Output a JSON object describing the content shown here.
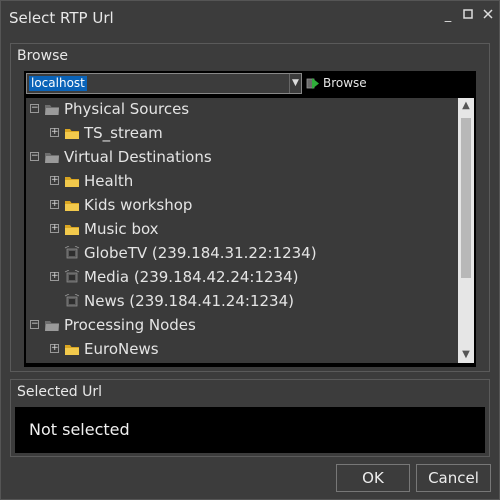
{
  "window": {
    "title": "Select RTP Url"
  },
  "browse": {
    "title": "Browse",
    "host": "localhost",
    "browse_button": "Browse"
  },
  "tree": {
    "nodes": [
      {
        "label": "Physical Sources",
        "level": 0,
        "icon": "folder-gray-icon",
        "expander": "minus"
      },
      {
        "label": "TS_stream",
        "level": 1,
        "icon": "folder-yellow-icon",
        "expander": "plus"
      },
      {
        "label": "Virtual Destinations",
        "level": 0,
        "icon": "folder-gray-icon",
        "expander": "minus"
      },
      {
        "label": "Health",
        "level": 1,
        "icon": "folder-yellow-icon",
        "expander": "plus"
      },
      {
        "label": "Kids workshop",
        "level": 1,
        "icon": "folder-yellow-icon",
        "expander": "plus"
      },
      {
        "label": "Music box",
        "level": 1,
        "icon": "folder-yellow-icon",
        "expander": "plus"
      },
      {
        "label": "GlobeTV (239.184.31.22:1234)",
        "level": 1,
        "icon": "stream-icon",
        "expander": "none"
      },
      {
        "label": "Media (239.184.42.24:1234)",
        "level": 1,
        "icon": "stream-icon",
        "expander": "plus"
      },
      {
        "label": "News  (239.184.41.24:1234)",
        "level": 1,
        "icon": "stream-icon",
        "expander": "none"
      },
      {
        "label": "Processing Nodes",
        "level": 0,
        "icon": "folder-gray-icon",
        "expander": "minus"
      },
      {
        "label": "EuroNews",
        "level": 1,
        "icon": "folder-yellow-icon",
        "expander": "plus"
      }
    ]
  },
  "selected": {
    "title": "Selected Url",
    "value": "Not selected"
  },
  "buttons": {
    "ok": "OK",
    "cancel": "Cancel"
  },
  "colors": {
    "background": "#3c3c3c",
    "highlight": "#0a63b8",
    "folder_yellow": "#f2c94c",
    "text": "#e6e6e6"
  }
}
